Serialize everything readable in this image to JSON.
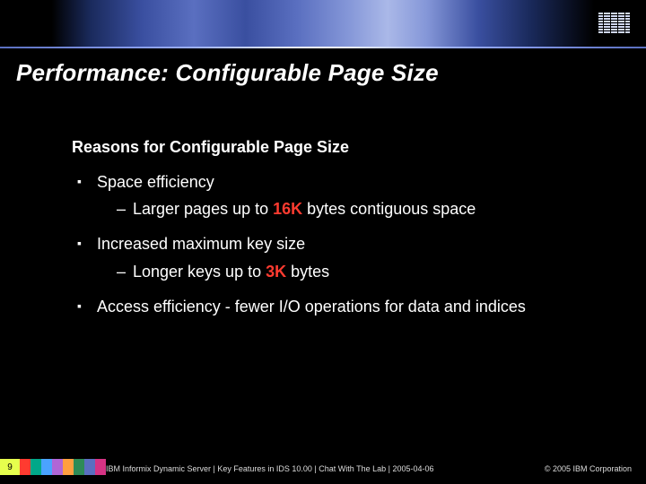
{
  "logo_name": "IBM",
  "title": "Performance: Configurable Page Size",
  "section_heading": "Reasons for Configurable Page Size",
  "bullets": {
    "b0": {
      "text": "Space efficiency"
    },
    "d0": {
      "pre": "Larger pages up to ",
      "hl": "16K",
      "post": " bytes contiguous space"
    },
    "b1": {
      "text": "Increased maximum key size"
    },
    "d1": {
      "pre": "Longer keys up to ",
      "hl": "3K",
      "post": " bytes"
    },
    "b2": {
      "text": "Access efficiency - fewer I/O operations for data and indices"
    }
  },
  "footer": {
    "page_number": "9",
    "text": "IBM Informix Dynamic Server  |  Key Features in IDS 10.00  |  Chat With The Lab  |  2005-04-06",
    "copyright": "© 2005 IBM Corporation",
    "stripe_colors": [
      "#ff3b30",
      "#00a889",
      "#4aa3ff",
      "#b066d6",
      "#ff9f40",
      "#2e8b57",
      "#5a6fc0",
      "#d63384"
    ]
  }
}
